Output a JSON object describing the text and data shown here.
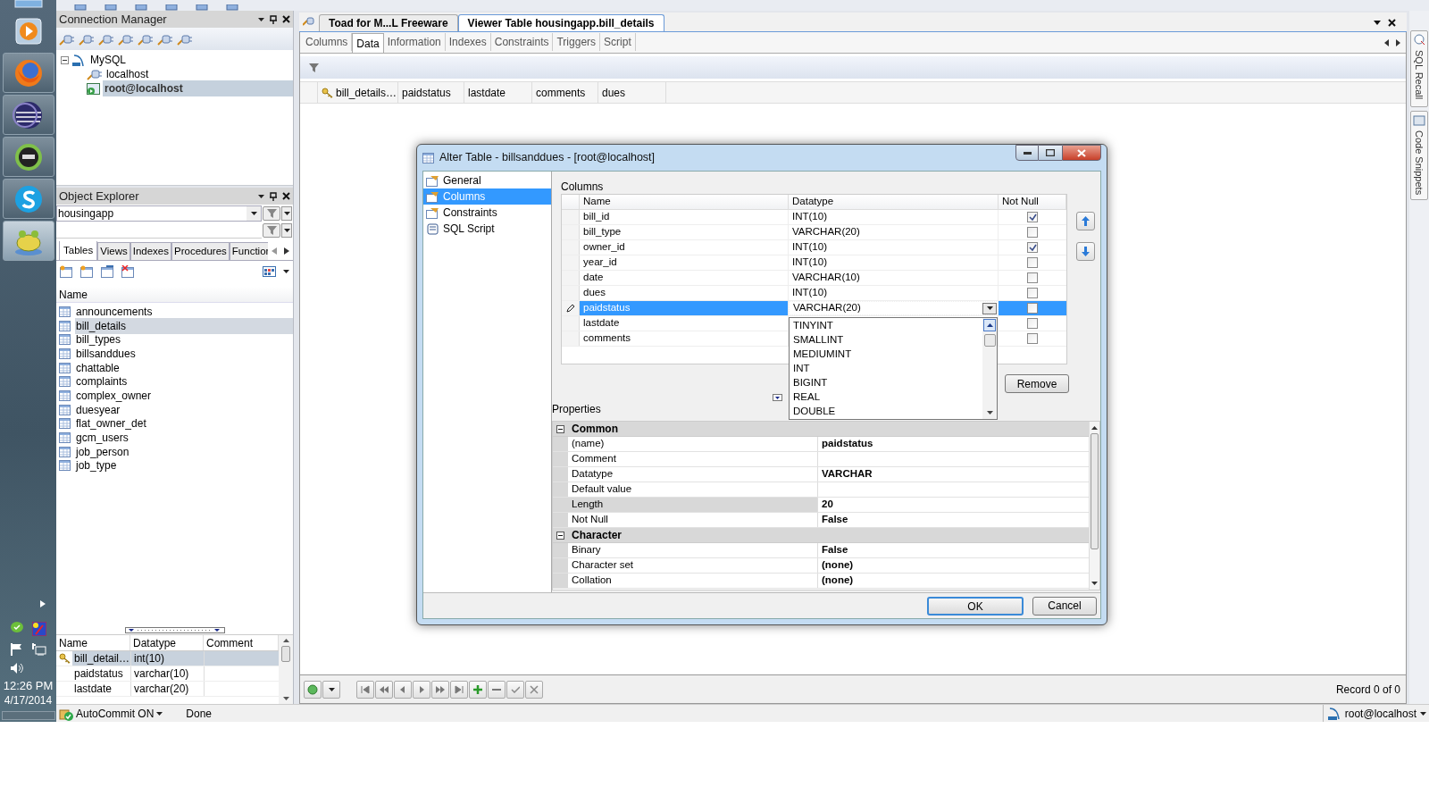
{
  "taskbar": {
    "time": "12:26 PM",
    "date": "4/17/2014"
  },
  "connection_manager": {
    "title": "Connection Manager",
    "tree": [
      {
        "label": "MySQL",
        "expanded": true,
        "selected": false,
        "children": [
          {
            "label": "localhost",
            "selected": false
          },
          {
            "label": "root@localhost",
            "selected": true
          }
        ]
      }
    ]
  },
  "object_explorer": {
    "title": "Object Explorer",
    "schema": "housingapp",
    "tabs": [
      {
        "label": "Tables",
        "selected": true
      },
      {
        "label": "Views",
        "selected": false
      },
      {
        "label": "Indexes",
        "selected": false
      },
      {
        "label": "Procedures",
        "selected": false
      },
      {
        "label": "Functior",
        "selected": false
      }
    ],
    "list_header": "Name",
    "tables": [
      {
        "name": "announcements",
        "selected": false
      },
      {
        "name": "bill_details",
        "selected": true
      },
      {
        "name": "bill_types",
        "selected": false
      },
      {
        "name": "billsanddues",
        "selected": false
      },
      {
        "name": "chattable",
        "selected": false
      },
      {
        "name": "complaints",
        "selected": false
      },
      {
        "name": "complex_owner",
        "selected": false
      },
      {
        "name": "duesyear",
        "selected": false
      },
      {
        "name": "flat_owner_det",
        "selected": false
      },
      {
        "name": "gcm_users",
        "selected": false
      },
      {
        "name": "job_person",
        "selected": false
      },
      {
        "name": "job_type",
        "selected": false
      }
    ],
    "columns_grid": {
      "columns": [
        "Name",
        "Datatype",
        "Comment"
      ],
      "rows": [
        {
          "name": "bill_detail…",
          "datatype": "int(10)",
          "key": true,
          "selected": true
        },
        {
          "name": "paidstatus",
          "datatype": "varchar(10)",
          "key": false,
          "selected": false
        },
        {
          "name": "lastdate",
          "datatype": "varchar(20)",
          "key": false,
          "selected": false
        }
      ]
    }
  },
  "document_tabs": [
    {
      "label": "Toad for M...L Freeware",
      "selected": false
    },
    {
      "label": "Viewer Table housingapp.bill_details",
      "selected": true
    }
  ],
  "viewer_tabs": [
    {
      "label": "Columns",
      "selected": false
    },
    {
      "label": "Data",
      "selected": true
    },
    {
      "label": "Information",
      "selected": false
    },
    {
      "label": "Indexes",
      "selected": false
    },
    {
      "label": "Constraints",
      "selected": false
    },
    {
      "label": "Triggers",
      "selected": false
    },
    {
      "label": "Script",
      "selected": false
    }
  ],
  "data_grid": {
    "columns": [
      {
        "label": "bill_details…",
        "key": true
      },
      {
        "label": "paidstatus",
        "key": false
      },
      {
        "label": "lastdate",
        "key": false
      },
      {
        "label": "comments",
        "key": false
      },
      {
        "label": "dues",
        "key": false
      }
    ]
  },
  "navigator": {
    "record": "Record 0 of 0"
  },
  "side_tabs": [
    "SQL Recall",
    "Code Snippets"
  ],
  "dialog": {
    "title": "Alter Table - billsanddues - [root@localhost]",
    "nav": [
      {
        "label": "General",
        "selected": false
      },
      {
        "label": "Columns",
        "selected": true
      },
      {
        "label": "Constraints",
        "selected": false
      },
      {
        "label": "SQL Script",
        "selected": false
      }
    ],
    "columns_label": "Columns",
    "grid_columns": [
      "Name",
      "Datatype",
      "Not Null"
    ],
    "rows": [
      {
        "name": "bill_id",
        "datatype": "INT(10)",
        "not_null": true,
        "selected": false,
        "editing": false
      },
      {
        "name": "bill_type",
        "datatype": "VARCHAR(20)",
        "not_null": false,
        "selected": false,
        "editing": false
      },
      {
        "name": "owner_id",
        "datatype": "INT(10)",
        "not_null": true,
        "selected": false,
        "editing": false
      },
      {
        "name": "year_id",
        "datatype": "INT(10)",
        "not_null": false,
        "selected": false,
        "editing": false
      },
      {
        "name": "date",
        "datatype": "VARCHAR(10)",
        "not_null": false,
        "selected": false,
        "editing": false
      },
      {
        "name": "dues",
        "datatype": "INT(10)",
        "not_null": false,
        "selected": false,
        "editing": false
      },
      {
        "name": "paidstatus",
        "datatype": "VARCHAR(20)",
        "not_null": false,
        "selected": true,
        "editing": true
      },
      {
        "name": "lastdate",
        "not_null": false,
        "selected": false,
        "editing": false
      },
      {
        "name": "comments",
        "not_null": false,
        "selected": false,
        "editing": false
      }
    ],
    "dropdown": {
      "options": [
        "TINYINT",
        "SMALLINT",
        "MEDIUMINT",
        "INT",
        "BIGINT",
        "REAL",
        "DOUBLE"
      ]
    },
    "remove": "Remove",
    "properties_label": "Properties",
    "property_groups": [
      {
        "title": "Common",
        "expanded": true,
        "items": [
          {
            "name": "(name)",
            "value": "paidstatus",
            "selected": false
          },
          {
            "name": "Comment",
            "selected": false
          },
          {
            "name": "Datatype",
            "value": "VARCHAR",
            "selected": false
          },
          {
            "name": "Default value",
            "selected": false
          },
          {
            "name": "Length",
            "value": "20",
            "selected": true
          },
          {
            "name": "Not Null",
            "value": "False",
            "selected": false
          }
        ]
      },
      {
        "title": "Character",
        "expanded": true,
        "items": [
          {
            "name": "Binary",
            "value": "False",
            "selected": false
          },
          {
            "name": "Character set",
            "value": "(none)",
            "selected": false
          },
          {
            "name": "Collation",
            "value": "(none)",
            "selected": false
          }
        ]
      }
    ],
    "buttons": [
      {
        "label": "OK",
        "default": true
      },
      {
        "label": "Cancel",
        "default": false
      }
    ]
  },
  "status_bar": {
    "autocommit": "AutoCommit ON",
    "status": "Done",
    "connection": "root@localhost"
  }
}
